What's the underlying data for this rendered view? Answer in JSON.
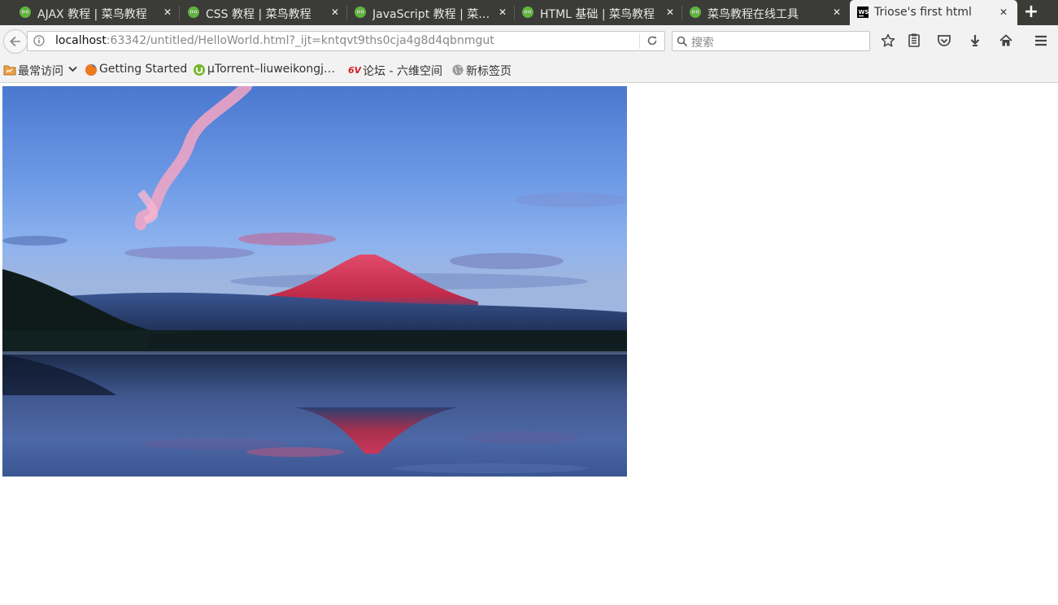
{
  "tabs": [
    {
      "title": "AJAX 教程 | 菜鸟教程",
      "icon": "runoob-icon",
      "active": false
    },
    {
      "title": "CSS 教程 | 菜鸟教程",
      "icon": "runoob-icon",
      "active": false
    },
    {
      "title": "JavaScript 教程 | 菜…",
      "icon": "runoob-icon",
      "active": false
    },
    {
      "title": "HTML 基础 | 菜鸟教程",
      "icon": "runoob-icon",
      "active": false
    },
    {
      "title": "菜鸟教程在线工具",
      "icon": "runoob-icon",
      "active": false
    },
    {
      "title": "Triose's first html",
      "icon": "webstorm-icon",
      "active": true
    }
  ],
  "navbar": {
    "url_host": "localhost",
    "url_rest": ":63342/untitled/HelloWorld.html?_ijt=kntqvt9ths0cja4g8d4qbnmgut",
    "search_placeholder": "搜索"
  },
  "bookmarks": [
    {
      "label": "最常访问",
      "icon": "most-visited-folder-icon"
    },
    {
      "label": "Getting Started",
      "icon": "firefox-icon"
    },
    {
      "label": "μTorrent–liuweikongj…",
      "icon": "utorrent-icon"
    },
    {
      "label": "论坛 - 六维空间",
      "icon": "6v-icon"
    },
    {
      "label": "新标签页",
      "icon": "globe-icon"
    }
  ],
  "content": {
    "image": "mount-fuji-sunset-photo"
  },
  "colors": {
    "tabstrip": "#3b3b38",
    "toolbar": "#f2f2f2",
    "runoob_green": "#5fb53f",
    "fuji_red": "#d9364f",
    "sky_blue": "#5b8fd8"
  }
}
